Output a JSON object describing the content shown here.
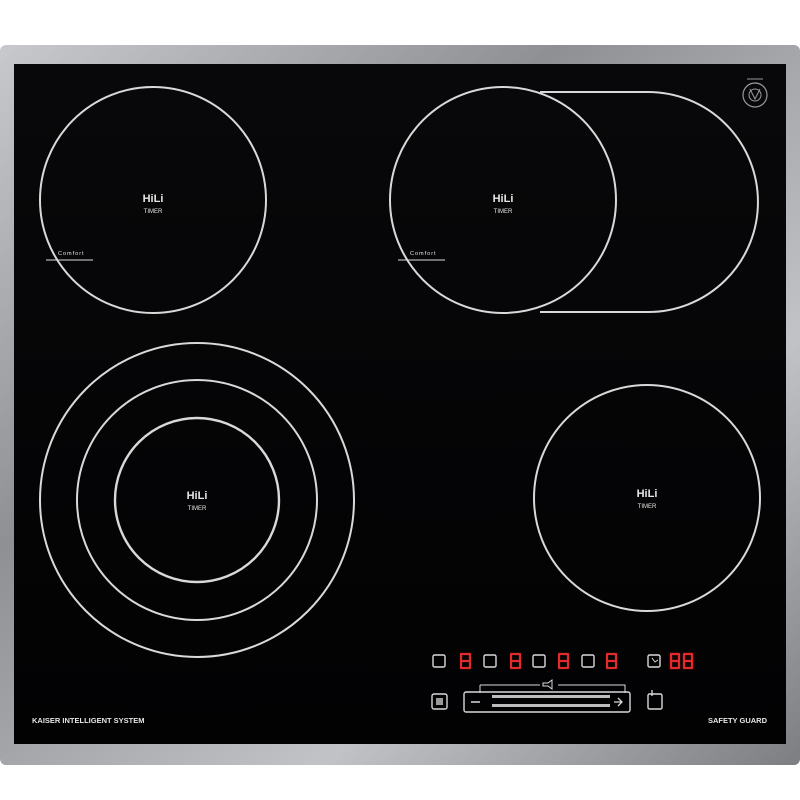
{
  "colors": {
    "glass": "#050506",
    "frame": "#a9abae",
    "line": "#d9d9d9",
    "display_red": "#e22a2a"
  },
  "zones": [
    {
      "id": "rear-left",
      "brand": "HiLi",
      "label": "TIMER",
      "comfort": "Comfort"
    },
    {
      "id": "rear-right",
      "brand": "HiLi",
      "label": "TIMER",
      "comfort": "Comfort"
    },
    {
      "id": "front-left",
      "brand": "HiLi",
      "label": "TIMER"
    },
    {
      "id": "front-right",
      "brand": "HiLi",
      "label": "TIMER"
    }
  ],
  "footer": {
    "left_text": "KAISER INTELLIGENT SYSTEM",
    "right_text": "SAFETY GUARD"
  },
  "controls": {
    "zone_displays": [
      "8",
      "8",
      "8",
      "8"
    ],
    "timer_display": "88",
    "icons": [
      "zone-select-icon",
      "timer-clock-icon",
      "lock-icon",
      "power-icon",
      "volume-icon"
    ]
  }
}
